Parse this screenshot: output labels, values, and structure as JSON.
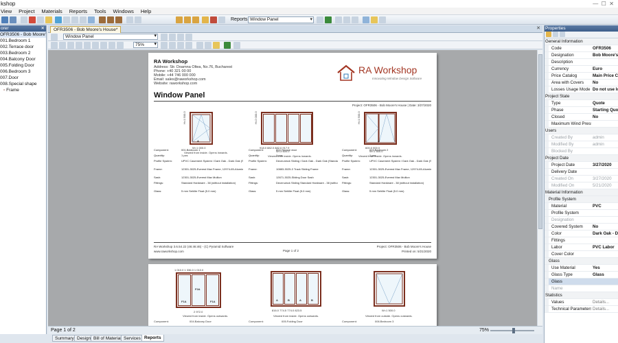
{
  "app": {
    "title": "RA Workshop",
    "title_visible": "kshop",
    "menu": [
      "View",
      "Project",
      "Materials",
      "Reports",
      "Tools",
      "Windows",
      "Help"
    ]
  },
  "toolbar": {
    "reports_label": "Reports:",
    "reports_value": "Window Panel"
  },
  "explorer": {
    "header": "orer",
    "root": "OFR3506 - Bob Moore's House",
    "items": [
      "001.Bedroom 1",
      "002.Terrace door",
      "003.Bedroom 2",
      "004.Balcony Door",
      "005.Folding Door",
      "006.Bedroom 3",
      "007.Door",
      "008.Special shape",
      "Frame"
    ]
  },
  "document": {
    "tab_label": "OFR3506 - Bob Moore's House*",
    "report_combo": "Window Panel",
    "zoom": "75%",
    "page_status": "Page 1 of 2",
    "zoom_status": "75%"
  },
  "report": {
    "company": "RA Workshop",
    "address": "Address: Str. Doamna Oltea, No.76, Bucharest",
    "phone": "Phone: +40 321 00 00",
    "mobile": "Mobile: +44 746 000 000",
    "email": "Email: sales@raworkshop.com",
    "website": "Website: raworkshop.com",
    "logo_brand": "RA Workshop",
    "logo_tag": "Innovating Window Design Software",
    "title": "Window Panel",
    "project_line": "Project: OFR3506 - Bob Moore's House | Date: 3/27/2020",
    "windows": [
      {
        "height_dim": "H=1 500.0",
        "width_dim": "W=1 000.0",
        "label": "A",
        "viewed": "Viewed from inside. Opens inwards.",
        "rows": [
          [
            "Component:",
            "001.Bedroom 1"
          ],
          [
            "Quantity:",
            "1 pcs"
          ],
          [
            "Profile System:",
            "UPVC Casement System / Dark Oak - Dark Oak (Standard)"
          ],
          [
            "Frame:",
            "12301-3025-Everest Max Frame, 12974-65-Aluminum Threshold 20 mm"
          ],
          [
            "Sash:",
            "12301-3025-Everest Max Mullion"
          ],
          [
            "Fittings:",
            "Standard Hardware - 38 (without installation)"
          ],
          [
            "Glass:",
            "5 mm Sehlite Float (5.0 mm)"
          ]
        ]
      },
      {
        "height_dim": "H=2 000.0",
        "width_dim": "W=3 600.0",
        "segments": "918.0  882.0  882.0  917.9",
        "label": "",
        "viewed": "Viewed from inside. Opens inwards.",
        "rows": [
          [
            "Component:",
            "002.Terrace door"
          ],
          [
            "Quantity:",
            "1 pcs"
          ],
          [
            "Profile System:",
            "Deceuninck Sliding / Dark Oak - Dark Oak (Standard)"
          ],
          [
            "Frame:",
            "10883-3025-3 Track Sliding Frame"
          ],
          [
            "Sash:",
            "12671-3025-Sliding Door Sash"
          ],
          [
            "Fittings:",
            "Decenuinck Sliding Standard Hardware - 38 (without installation)"
          ],
          [
            "Glass:",
            "5 mm Sehlite Float (5.0 mm)"
          ]
        ]
      },
      {
        "height_dim": "H=1 500.0",
        "width_dim": "W=1 500.0",
        "segments": "600.0  900.0",
        "label": "A",
        "viewed": "Viewed from inside. Opens inwards.",
        "rows": [
          [
            "Component:",
            "003.Bedroom 2"
          ],
          [
            "Quantity:",
            "1 pcs"
          ],
          [
            "Profile System:",
            "UPVC Casement System / Dark Oak - Dark Oak (Standard)"
          ],
          [
            "Frame:",
            "12301-3025-Everest Max Frame, 12974-65-Aluminum Threshold 20 mm"
          ],
          [
            "Sash:",
            "12301-3025-Everest Max Mullion"
          ],
          [
            "Fittings:",
            "Standard Hardware - 38 (without installation)"
          ],
          [
            "Glass:",
            "5 mm Sehlite Float (5.0 mm)"
          ]
        ]
      }
    ],
    "footer_left": "RA Workshop 3.6.54.22 (46:46:46) - (C) Pyramid Software",
    "footer_left2": "www.raworkshop.com",
    "footer_center": "Page 1 of 2",
    "footer_right": "Project: OFR3506 - Bob Moore's House",
    "footer_right2": "Printed on: 5/21/2020",
    "page2": {
      "w1_top": "1 010.0  1 336.0  1 010.0",
      "w1_width": "2 972.0",
      "w1_labels": [
        "F1A",
        "F2A",
        "F1A"
      ],
      "w1_viewed": "Viewed from inside. Opens outwards.",
      "w2_bottom": "816.0  774.5  774.0  823.5",
      "w2_labels": [
        "A",
        "B",
        "A",
        "B"
      ],
      "w2_viewed": "Viewed from inside. Opens outwards.",
      "w3_width": "W=1 500.0",
      "w3_viewed": "Viewed from outside. Opens outwards.",
      "component_label": "Component:",
      "w1_component": "004.Balcony Door",
      "w2_component": "005.Folding Door",
      "w3_component": "006.Bedroom 3"
    }
  },
  "bottom_tabs": [
    "Summary",
    "Design",
    "Bill of Material",
    "Services",
    "Reports"
  ],
  "properties": {
    "header": "Properties",
    "categories": [
      {
        "name": "General Information",
        "rows": [
          {
            "n": "Code",
            "v": "OFR3506"
          },
          {
            "n": "Designation",
            "v": "Bob Moore's ho"
          },
          {
            "n": "Description",
            "v": ""
          },
          {
            "n": "Currency",
            "v": "Euro"
          },
          {
            "n": "Price Catalog",
            "v": "Main Price Ca"
          },
          {
            "n": "Area with Covers",
            "v": "No"
          },
          {
            "n": "Losses Usage Mode",
            "v": "Do not use lo"
          }
        ]
      },
      {
        "name": "Project State",
        "rows": [
          {
            "n": "Type",
            "v": "Quote"
          },
          {
            "n": "Phase",
            "v": "Starting Quot"
          },
          {
            "n": "Closed",
            "v": "No"
          },
          {
            "n": "Maximum Wind Pressur",
            "v": ""
          }
        ]
      },
      {
        "name": "Users",
        "rows": [
          {
            "n": "Created By",
            "v": "admin",
            "dim": true
          },
          {
            "n": "Modified By",
            "v": "admin",
            "dim": true
          },
          {
            "n": "Blocked By",
            "v": "",
            "dim": true
          }
        ]
      },
      {
        "name": "Project Date",
        "rows": [
          {
            "n": "Project Date",
            "v": "3/27/2020"
          },
          {
            "n": "Delivery Date",
            "v": ""
          },
          {
            "n": "Created On",
            "v": "3/27/2020",
            "dim": true
          },
          {
            "n": "Modified On",
            "v": "5/21/2020",
            "dim": true
          }
        ]
      },
      {
        "name": "Material Information",
        "rows": [
          {
            "n": "Profile System",
            "v": "",
            "cat": true
          },
          {
            "n": "Material",
            "v": "PVC"
          },
          {
            "n": "Profile System",
            "v": ""
          },
          {
            "n": "Designation",
            "v": "",
            "dim": true
          },
          {
            "n": "Covered System",
            "v": "No"
          },
          {
            "n": "Color",
            "v": "Dark Oak - D"
          },
          {
            "n": "Fittings",
            "v": ""
          },
          {
            "n": "Labor",
            "v": "PVC Labor"
          },
          {
            "n": "Cover Color",
            "v": ""
          },
          {
            "n": "Glass",
            "v": "",
            "cat": true
          },
          {
            "n": "Use Material",
            "v": "Yes"
          },
          {
            "n": "Glass Type",
            "v": "Glass"
          },
          {
            "n": "Glass",
            "v": "",
            "sel": true
          },
          {
            "n": "Name",
            "v": "",
            "dim": true
          }
        ]
      },
      {
        "name": "Statistics",
        "rows": [
          {
            "n": "Values",
            "v": "Details...",
            "plain": true
          },
          {
            "n": "Technical Parameters",
            "v": "Details...",
            "plain": true
          }
        ]
      }
    ]
  },
  "colors": {
    "accent": "#3c5d8a",
    "frame": "#7a2e1e",
    "brand": "#a33623"
  }
}
